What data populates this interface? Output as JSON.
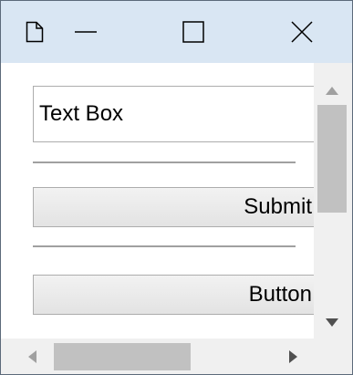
{
  "window": {
    "titlebar_icons": [
      "document-icon",
      "minimize-icon",
      "maximize-icon",
      "close-icon"
    ]
  },
  "form": {
    "text_box_value": "Text Box",
    "submit_label": "Submit",
    "button_label": "Button"
  },
  "scrollbars": {
    "vertical_position": 0.18,
    "horizontal_position": 0.2
  },
  "colors": {
    "titlebar": "#d9e6f3",
    "window_border": "#5c6a7a",
    "scroll_track": "#f0f0f0",
    "scroll_thumb": "#c1c1c1"
  }
}
